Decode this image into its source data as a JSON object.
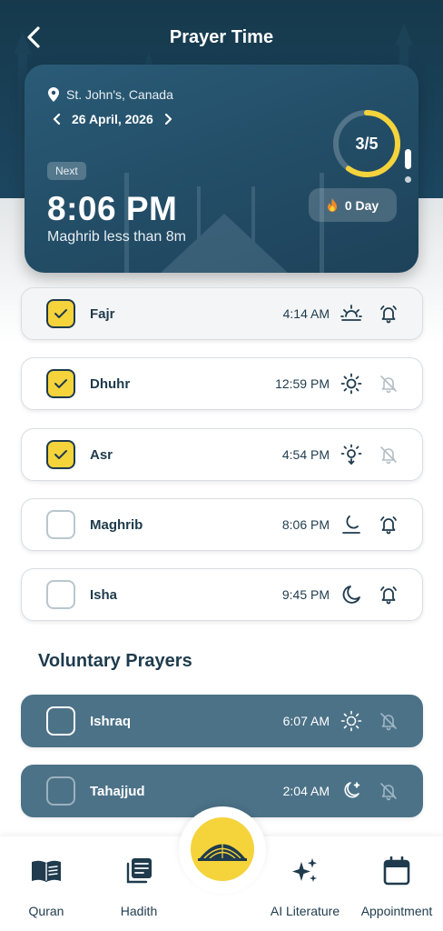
{
  "header": {
    "title": "Prayer Time"
  },
  "summary": {
    "location": "St. John's, Canada",
    "date": "26 April, 2026",
    "next_label": "Next",
    "next_time": "8:06 PM",
    "next_subtitle": "Maghrib less than 8m",
    "progress_text": "3/5",
    "progress_fraction": 0.6,
    "streak": "0 Day"
  },
  "prayers": [
    {
      "name": "Fajr",
      "time": "4:14 AM",
      "checked": true,
      "phase_icon": "sunrise-icon",
      "alarm": "bell-on-icon"
    },
    {
      "name": "Dhuhr",
      "time": "12:59 PM",
      "checked": true,
      "phase_icon": "sun-icon",
      "alarm": "bell-off-icon"
    },
    {
      "name": "Asr",
      "time": "4:54 PM",
      "checked": true,
      "phase_icon": "sun-down-icon",
      "alarm": "bell-off-icon"
    },
    {
      "name": "Maghrib",
      "time": "8:06 PM",
      "checked": false,
      "phase_icon": "sunset-moon-icon",
      "alarm": "bell-on-icon"
    },
    {
      "name": "Isha",
      "time": "9:45 PM",
      "checked": false,
      "phase_icon": "moon-icon",
      "alarm": "bell-on-icon"
    }
  ],
  "voluntary": {
    "title": "Voluntary Prayers",
    "items": [
      {
        "name": "Ishraq",
        "time": "6:07 AM",
        "checked": false,
        "phase_icon": "sun-rays-icon",
        "alarm": "bell-off-icon"
      },
      {
        "name": "Tahajjud",
        "time": "2:04 AM",
        "checked": false,
        "phase_icon": "moon-star-icon",
        "alarm": "bell-off-icon"
      }
    ]
  },
  "nav": {
    "quran": "Quran",
    "hadith": "Hadith",
    "ai_literature": "AI Literature",
    "appointment": "Appointment"
  },
  "colors": {
    "primary_dark": "#1f3b4d",
    "accent_yellow": "#f5d33b",
    "voluntary_bg": "#4c7288",
    "streak_fire": "#f08a24"
  }
}
